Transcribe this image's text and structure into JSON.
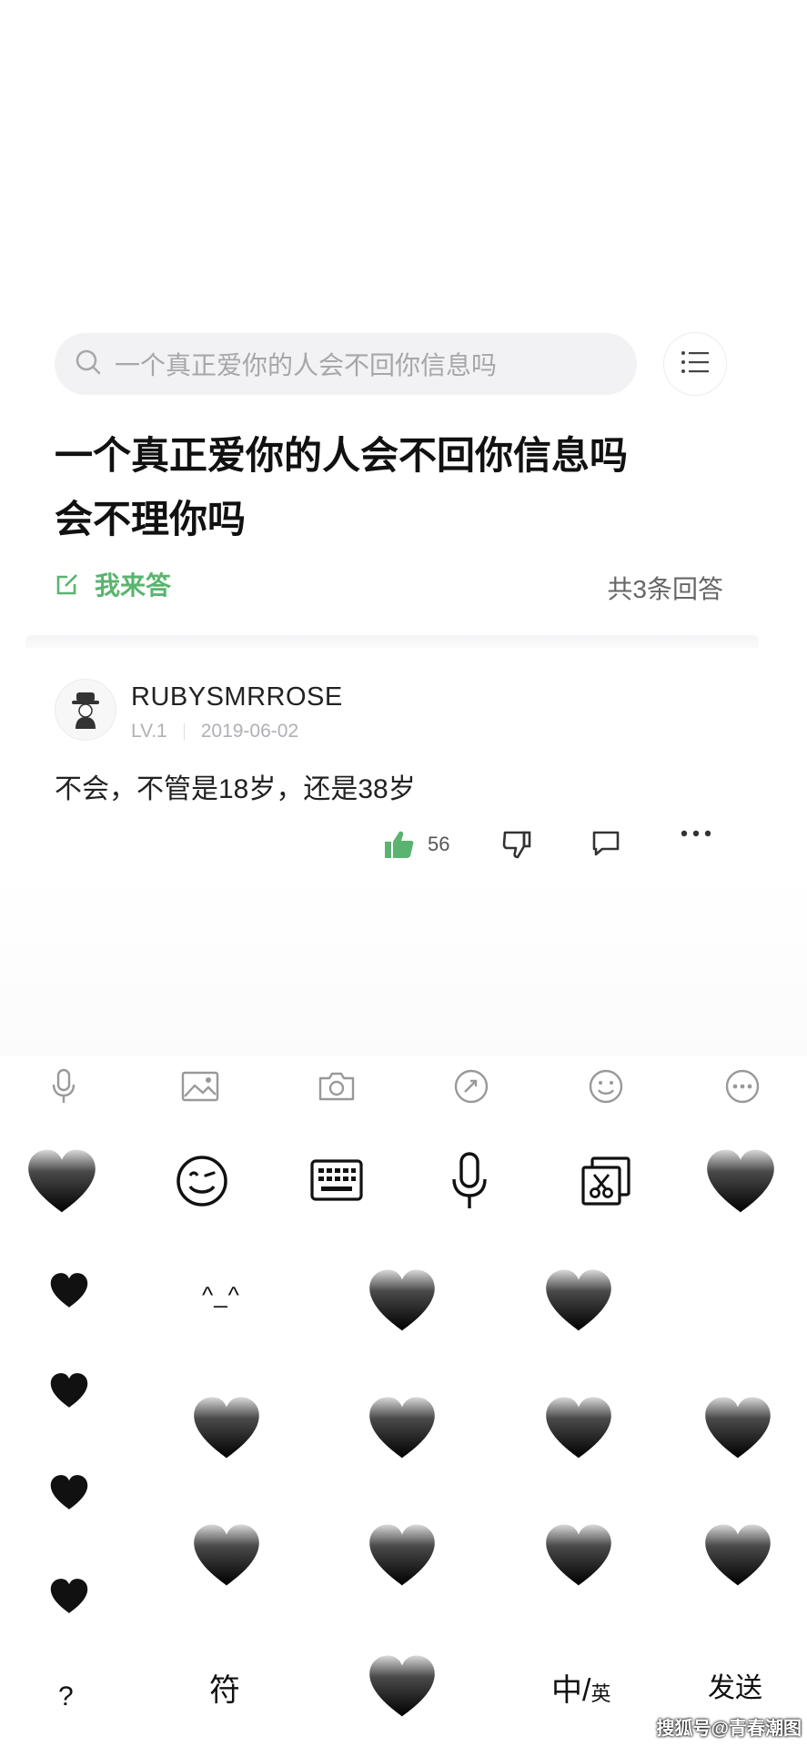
{
  "search": {
    "placeholder": "一个真正爱你的人会不回你信息吗"
  },
  "question": {
    "title_line1": "一个真正爱你的人会不回你信息吗",
    "title_line2": "会不理你吗",
    "answer_button_label": "我来答",
    "answer_count": "共3条回答"
  },
  "answer": {
    "username": "RUBYSMRROSE",
    "level": "LV.1",
    "date": "2019-06-02",
    "text": "不会，不管是18岁，还是38岁",
    "like_count": "56"
  },
  "toolbar": {
    "icons": [
      "microphone-icon",
      "image-icon",
      "camera-icon",
      "link-icon",
      "emoji-icon",
      "more-icon"
    ]
  },
  "keyboard": {
    "kaomoji": "^_^",
    "question_mark": "?",
    "symbols_key": "符",
    "lang_key_main": "中/",
    "lang_key_sub": "英",
    "send_key": "发送"
  },
  "watermark": "搜狐号@青春潮图",
  "colors": {
    "accent_green": "#5ab46f",
    "heart": "#111111"
  }
}
